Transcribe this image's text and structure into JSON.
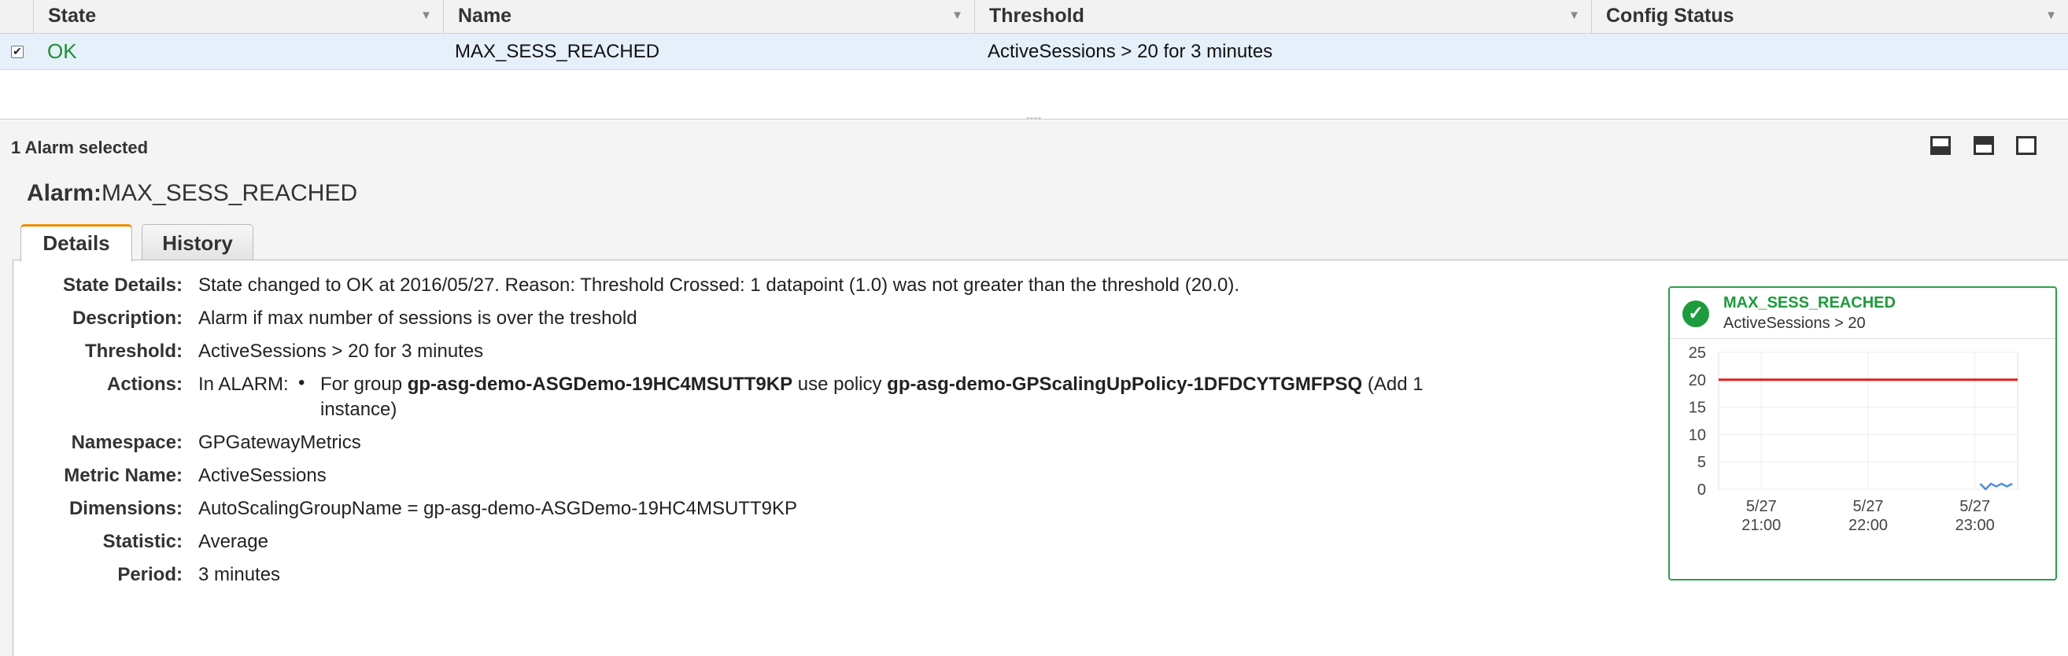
{
  "table": {
    "columns": [
      "State",
      "Name",
      "Threshold",
      "Config Status"
    ],
    "row": {
      "checked": true,
      "state": "OK",
      "name": "MAX_SESS_REACHED",
      "threshold": "ActiveSessions > 20 for 3 minutes",
      "config_status": ""
    }
  },
  "selection_text": "1 Alarm selected",
  "alarm": {
    "label": "Alarm:",
    "name": "MAX_SESS_REACHED"
  },
  "tabs": [
    "Details",
    "History"
  ],
  "details": {
    "state_details": {
      "key": "State Details:",
      "value": "State changed to OK at 2016/05/27. Reason: Threshold Crossed: 1 datapoint (1.0) was not greater than the threshold (20.0)."
    },
    "description": {
      "key": "Description:",
      "value": "Alarm if max number of sessions is over the treshold"
    },
    "threshold": {
      "key": "Threshold:",
      "value": "ActiveSessions > 20 for 3 minutes"
    },
    "actions": {
      "key": "Actions:",
      "in_alarm": "In ALARM:",
      "text_1": "For group ",
      "group": "gp-asg-demo-ASGDemo-19HC4MSUTT9KP",
      "text_2": " use policy ",
      "policy": "gp-asg-demo-GPScalingUpPolicy-1DFDCYTGMFPSQ",
      "text_3": " (Add 1",
      "text_4": "instance)"
    },
    "namespace": {
      "key": "Namespace:",
      "value": "GPGatewayMetrics"
    },
    "metric_name": {
      "key": "Metric Name:",
      "value": "ActiveSessions"
    },
    "dimensions": {
      "key": "Dimensions:",
      "value": "AutoScalingGroupName = gp-asg-demo-ASGDemo-19HC4MSUTT9KP"
    },
    "statistic": {
      "key": "Statistic:",
      "value": "Average"
    },
    "period": {
      "key": "Period:",
      "value": "3 minutes"
    }
  },
  "mini_chart": {
    "title": "MAX_SESS_REACHED",
    "subtitle": "ActiveSessions > 20",
    "status_icon": "check-circle-icon",
    "colors": {
      "ok": "#1e9b3c",
      "threshold": "#e0201c",
      "series": "#4a90d9"
    }
  },
  "chart_data": {
    "type": "line",
    "title": "",
    "ylim": [
      0,
      25
    ],
    "yticks": [
      0,
      5,
      10,
      15,
      20,
      25
    ],
    "xlim": [
      20.6,
      23.4
    ],
    "xticks": [
      {
        "x": 21,
        "line1": "5/27",
        "line2": "21:00"
      },
      {
        "x": 22,
        "line1": "5/27",
        "line2": "22:00"
      },
      {
        "x": 23,
        "line1": "5/27",
        "line2": "23:00"
      }
    ],
    "threshold": 20,
    "series": [
      {
        "x": [
          23.05,
          23.1,
          23.15,
          23.2,
          23.25,
          23.3,
          23.35
        ],
        "values": [
          1,
          0,
          1,
          0.5,
          1,
          0.5,
          1
        ]
      }
    ],
    "grid": true
  }
}
